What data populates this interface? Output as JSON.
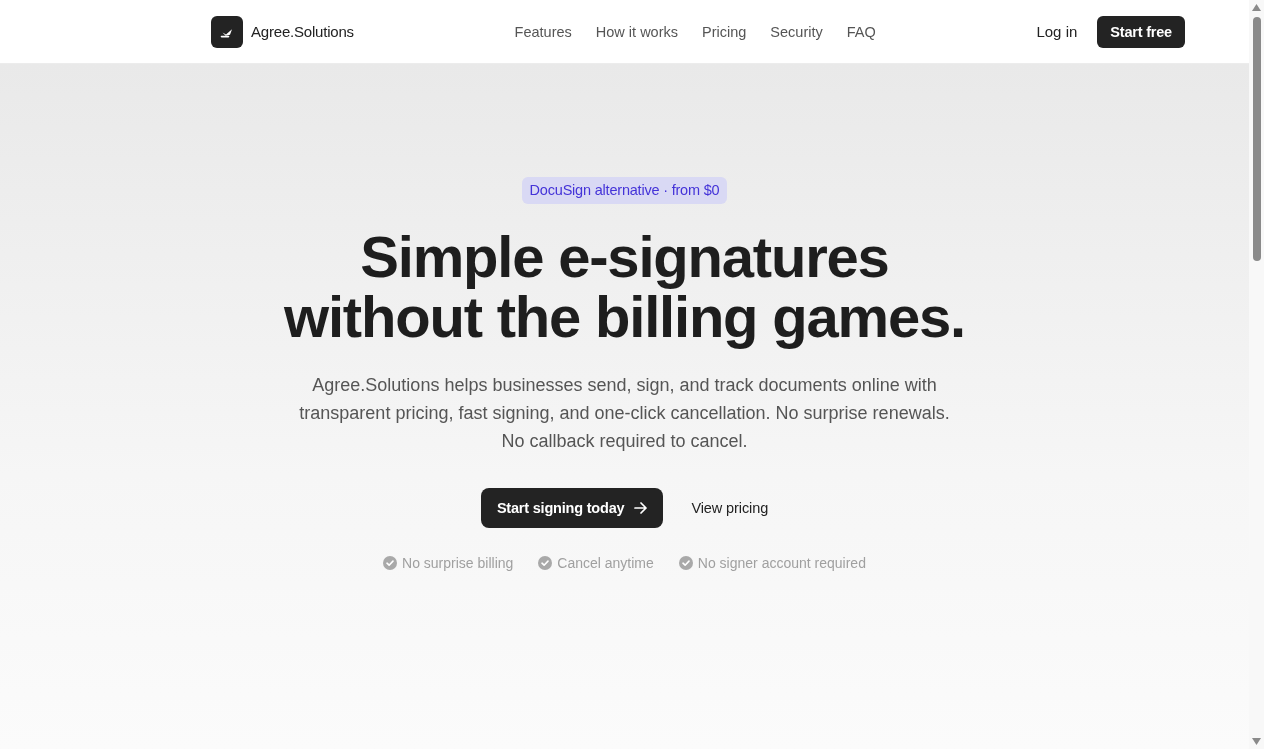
{
  "header": {
    "brand": "Agree.Solutions",
    "nav": [
      "Features",
      "How it works",
      "Pricing",
      "Security",
      "FAQ"
    ],
    "login": "Log in",
    "cta": "Start free"
  },
  "hero": {
    "badge": "DocuSign alternative · from $0",
    "headline": [
      "Simple e-signatures",
      "without the billing games."
    ],
    "description": "Agree.Solutions helps businesses send, sign, and track documents online with transparent pricing, fast signing, and one-click cancellation. No surprise renewals. No callback required to cancel.",
    "primary_button": "Start signing today",
    "secondary_button": "View pricing",
    "assurances": [
      "No surprise billing",
      "Cancel anytime",
      "No signer account required"
    ]
  }
}
